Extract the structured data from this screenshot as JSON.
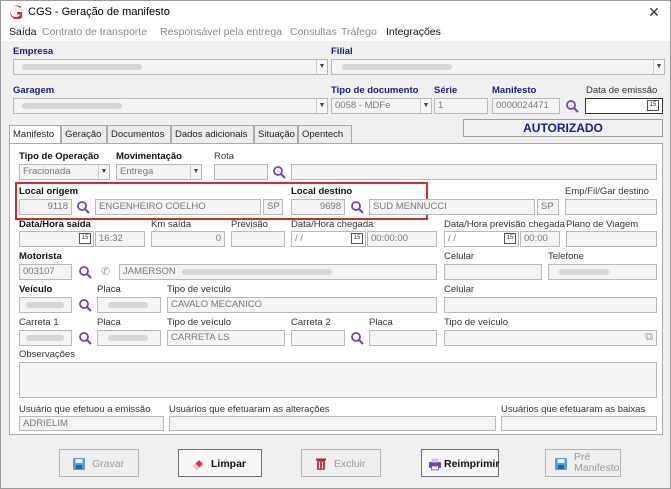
{
  "window": {
    "title": "CGS - Geração de manifesto",
    "close": "✕",
    "brand_color": "#d42a2a"
  },
  "menu": [
    {
      "label": "Saída",
      "active": true
    },
    {
      "label": "Contrato de transporte",
      "active": false
    },
    {
      "label": "Responsável pela entrega",
      "active": false
    },
    {
      "label": "Consultas",
      "active": false
    },
    {
      "label": "Tráfego",
      "active": false
    },
    {
      "label": "Integrações",
      "active": true
    }
  ],
  "header": {
    "empresa_label": "Empresa",
    "filial_label": "Filial",
    "garagem_label": "Garagem",
    "tipo_documento_label": "Tipo de documento",
    "tipo_documento_value": "0058 - MDFe",
    "serie_label": "Série",
    "serie_value": "1",
    "manifesto_label": "Manifesto",
    "manifesto_value": "0000024471",
    "data_emissao_label": "Data de emissão",
    "status": "AUTORIZADO"
  },
  "tabs": [
    "Manifesto",
    "Geração",
    "Documentos",
    "Dados adicionais",
    "Situação",
    "Opentech"
  ],
  "form": {
    "tipo_operacao_label": "Tipo de Operação",
    "tipo_operacao_value": "Fracionada",
    "movimentacao_label": "Movimentação",
    "movimentacao_value": "Entrega",
    "rota_label": "Rota",
    "local_origem_label": "Local origem",
    "local_origem_code": "9118",
    "local_origem_name": "ENGENHEIRO COELHO",
    "local_origem_uf": "SP",
    "local_destino_label": "Local destino",
    "local_destino_code": "9698",
    "local_destino_name": "SUD MENNUCCI",
    "local_destino_uf": "SP",
    "emp_fil_gar_label": "Emp/Fil/Gar destino",
    "data_hora_saida_label": "Data/Hora saída",
    "data_hora_saida_time": "16:32",
    "km_saida_label": "Km saída",
    "km_saida_value": "0",
    "previsao_label": "Previsão",
    "data_hora_chegada_label": "Data/Hora chegada",
    "data_hora_chegada_date": "/ /",
    "data_hora_chegada_time": "00:00:00",
    "data_hora_prev_chegada_label": "Data/Hora previsão chegada",
    "data_hora_prev_chegada_date": "/ /",
    "data_hora_prev_chegada_time": "00:00",
    "plano_viagem_label": "Plano de Viagem",
    "motorista_label": "Motorista",
    "motorista_code": "003107",
    "motorista_name": "JAMERSON",
    "celular_label": "Celular",
    "telefone_label": "Telefone",
    "veiculo_label": "Veículo",
    "placa_label": "Placa",
    "tipo_veiculo_label": "Tipo de veículo",
    "tipo_veiculo_value": "CAVALO MECANICO",
    "celular2_label": "Celular",
    "carreta1_label": "Carreta 1",
    "placa2_label": "Placa",
    "tipo_veiculo2_label": "Tipo de veículo",
    "tipo_veiculo2_value": "CARRETA LS",
    "carreta2_label": "Carreta 2",
    "placa3_label": "Placa",
    "tipo_veiculo3_label": "Tipo de veículo",
    "observacoes_label": "Observações",
    "usuario_emissao_label": "Usuário que efetuou a emissão",
    "usuario_emissao_value": "ADRIELIM",
    "usuarios_alteracoes_label": "Usuários que efetuaram as alterações",
    "usuarios_baixas_label": "Usuários que efetuaram as baixas"
  },
  "buttons": {
    "gravar": "Gravar",
    "limpar": "Limpar",
    "excluir": "Excluir",
    "reimprimir": "Reimprimir",
    "pre_manifesto_1": "Pré",
    "pre_manifesto_2": "Manifesto"
  },
  "icons": {
    "app": "cgs-logo-icon",
    "search": "magnifier-icon",
    "calendar": "calendar-icon"
  }
}
